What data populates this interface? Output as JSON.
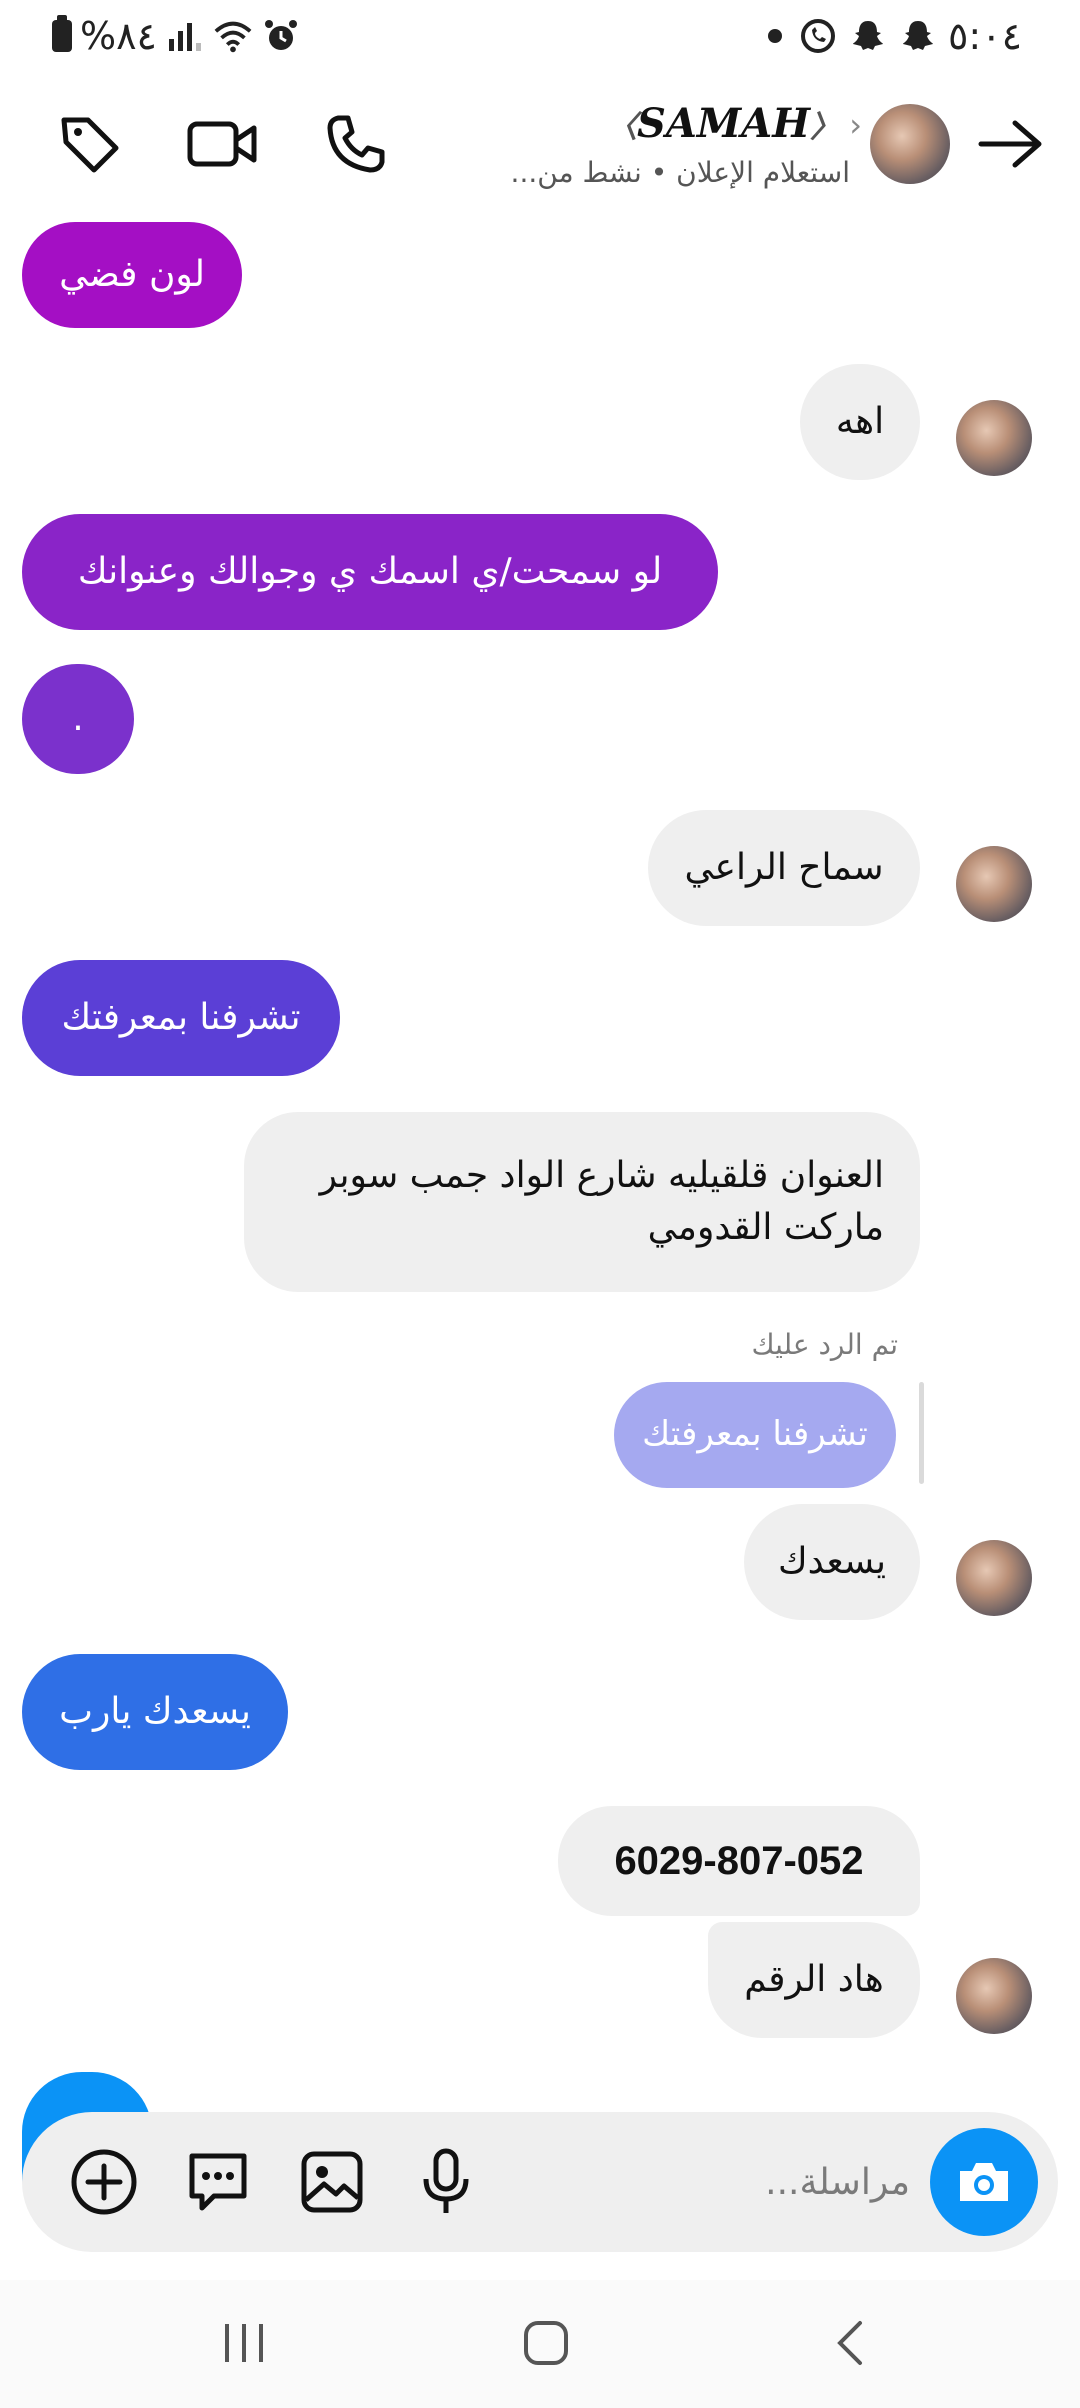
{
  "status_bar": {
    "time": "٥:٠٤",
    "battery": "%٨٤"
  },
  "header": {
    "name": "SAMAH",
    "subtitle": "استعلام الإعلان • نشط من..."
  },
  "messages": [
    {
      "text": "لون فضي"
    },
    {
      "text": "اهه"
    },
    {
      "text": "لو سمحت/ي اسمك ي وجوالك وعنوانك"
    },
    {
      "text": "."
    },
    {
      "text": "سماح الراعي"
    },
    {
      "text": "تشرفنا بمعرفتك"
    },
    {
      "line1": "العنوان قلقيليه شارع الواد جمب سوبر",
      "line2": "ماركت القدومي"
    },
    {
      "reply_label": "تم الرد عليك",
      "quoted": "تشرفنا بمعرفتك"
    },
    {
      "text": "يسعدك"
    },
    {
      "text": "يسعدك يارب"
    },
    {
      "text": "6029-807-052"
    },
    {
      "text": "هاد الرقم"
    }
  ],
  "composer": {
    "placeholder": "مراسلة..."
  },
  "colors": {
    "accent_blue": "#0b93f6",
    "bubble_in": "#efefef",
    "purple_1": "#a40fc4",
    "purple_2": "#8a24c8",
    "purple_3": "#7b31cc",
    "indigo": "#5b3fd6",
    "blue": "#2f6fe6",
    "reply_quote": "#a5a9f0"
  },
  "icons": [
    "battery-icon",
    "signal-icon",
    "wifi-icon",
    "alarm-icon",
    "whatsapp-icon",
    "snapchat-icon",
    "tag-icon",
    "video-call-icon",
    "phone-icon",
    "back-arrow-icon",
    "camera-icon",
    "add-icon",
    "chat-icon",
    "gallery-icon",
    "microphone-icon"
  ]
}
